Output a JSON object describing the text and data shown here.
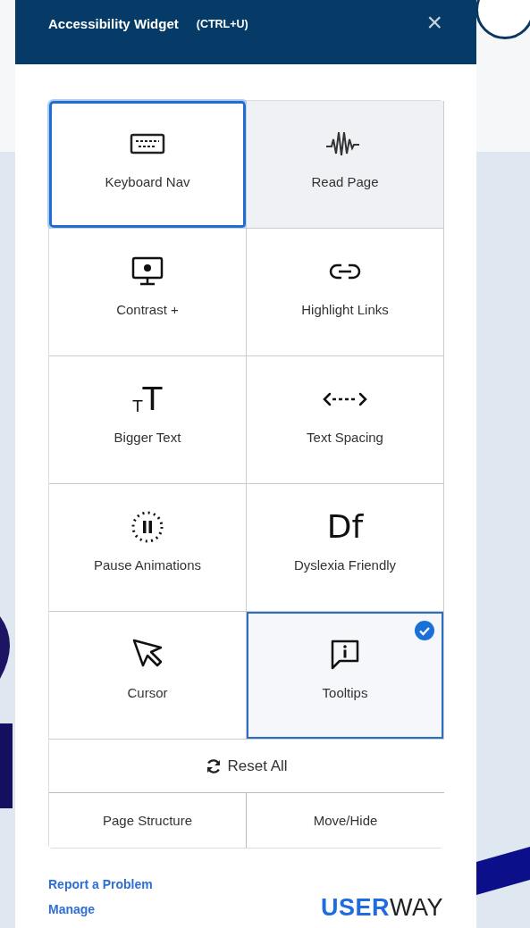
{
  "header": {
    "title": "Accessibility Widget",
    "shortcut": "(CTRL+U)",
    "close": "×"
  },
  "tiles": [
    {
      "label": "Keyboard Nav",
      "focused": true,
      "hovered": false,
      "selected": false
    },
    {
      "label": "Read Page",
      "focused": false,
      "hovered": true,
      "selected": false
    },
    {
      "label": "Contrast +",
      "focused": false,
      "hovered": false,
      "selected": false
    },
    {
      "label": "Highlight Links",
      "focused": false,
      "hovered": false,
      "selected": false
    },
    {
      "label": "Bigger Text",
      "kind": "glyph",
      "focused": false,
      "hovered": false,
      "selected": false
    },
    {
      "label": "Text Spacing",
      "focused": false,
      "hovered": false,
      "selected": false
    },
    {
      "label": "Pause Animations",
      "focused": false,
      "hovered": false,
      "selected": false
    },
    {
      "label": "Dyslexia Friendly",
      "kind": "glyph",
      "focused": false,
      "hovered": false,
      "selected": false
    },
    {
      "label": "Cursor",
      "focused": false,
      "hovered": false,
      "selected": false
    },
    {
      "label": "Tooltips",
      "focused": false,
      "hovered": false,
      "selected": true
    }
  ],
  "glyph_icons": [
    "$_{T}$T",
    "Df"
  ],
  "reset": "Reset All",
  "bottom_buttons": [
    "Page Structure",
    "Move/Hide"
  ],
  "links": [
    "Report a Problem",
    "Manage"
  ],
  "logo": "**USER**WAY"
}
